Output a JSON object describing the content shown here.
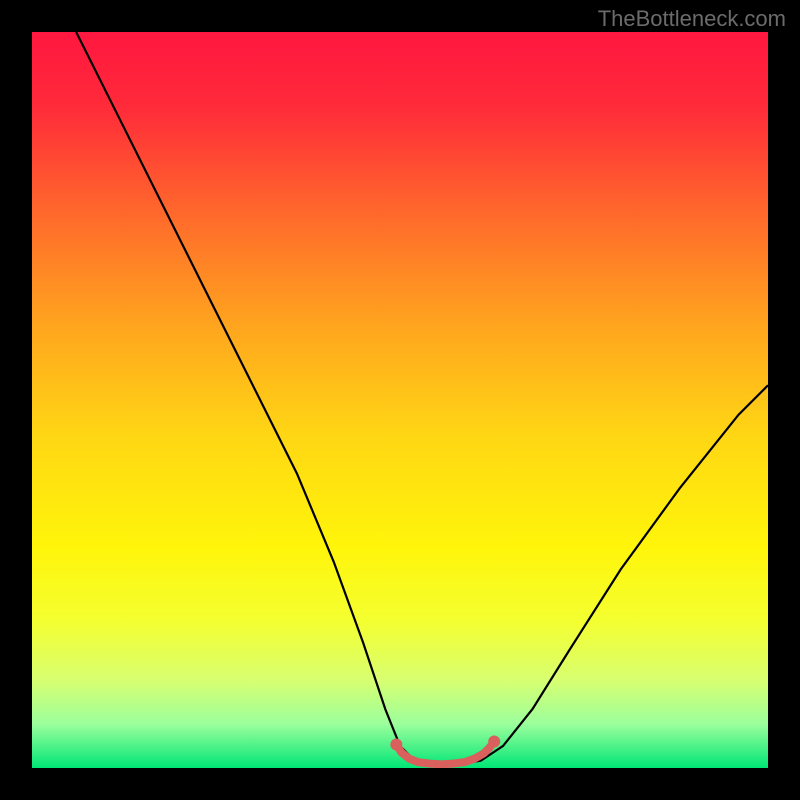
{
  "watermark": "TheBottleneck.com",
  "chart_data": {
    "type": "line",
    "title": "",
    "xlabel": "",
    "ylabel": "",
    "xlim": [
      0,
      100
    ],
    "ylim": [
      0,
      100
    ],
    "gradient_stops": [
      {
        "offset": 0.0,
        "color": "#ff173f"
      },
      {
        "offset": 0.1,
        "color": "#ff2a3a"
      },
      {
        "offset": 0.25,
        "color": "#ff6a2b"
      },
      {
        "offset": 0.4,
        "color": "#ffa51e"
      },
      {
        "offset": 0.55,
        "color": "#ffd714"
      },
      {
        "offset": 0.7,
        "color": "#fff50a"
      },
      {
        "offset": 0.8,
        "color": "#f4ff30"
      },
      {
        "offset": 0.88,
        "color": "#d8ff70"
      },
      {
        "offset": 0.94,
        "color": "#9cff9c"
      },
      {
        "offset": 1.0,
        "color": "#00e676"
      }
    ],
    "series": [
      {
        "name": "bottleneck-curve",
        "points": [
          [
            6,
            100
          ],
          [
            12,
            88
          ],
          [
            18,
            76
          ],
          [
            24,
            64
          ],
          [
            30,
            52
          ],
          [
            36,
            40
          ],
          [
            41,
            28
          ],
          [
            45,
            17
          ],
          [
            48,
            8
          ],
          [
            50,
            3
          ],
          [
            52,
            1
          ],
          [
            55,
            0.5
          ],
          [
            58,
            0.5
          ],
          [
            61,
            1
          ],
          [
            64,
            3
          ],
          [
            68,
            8
          ],
          [
            73,
            16
          ],
          [
            80,
            27
          ],
          [
            88,
            38
          ],
          [
            96,
            48
          ],
          [
            100,
            52
          ]
        ]
      },
      {
        "name": "optimal-segment",
        "color": "#d9605d",
        "points": [
          [
            49.5,
            3.2
          ],
          [
            50.2,
            2.1
          ],
          [
            51.2,
            1.3
          ],
          [
            52.4,
            0.8
          ],
          [
            54.0,
            0.6
          ],
          [
            55.6,
            0.5
          ],
          [
            57.2,
            0.6
          ],
          [
            58.8,
            0.8
          ],
          [
            60.2,
            1.3
          ],
          [
            61.4,
            2.0
          ],
          [
            62.2,
            2.8
          ],
          [
            62.8,
            3.6
          ]
        ]
      }
    ]
  }
}
